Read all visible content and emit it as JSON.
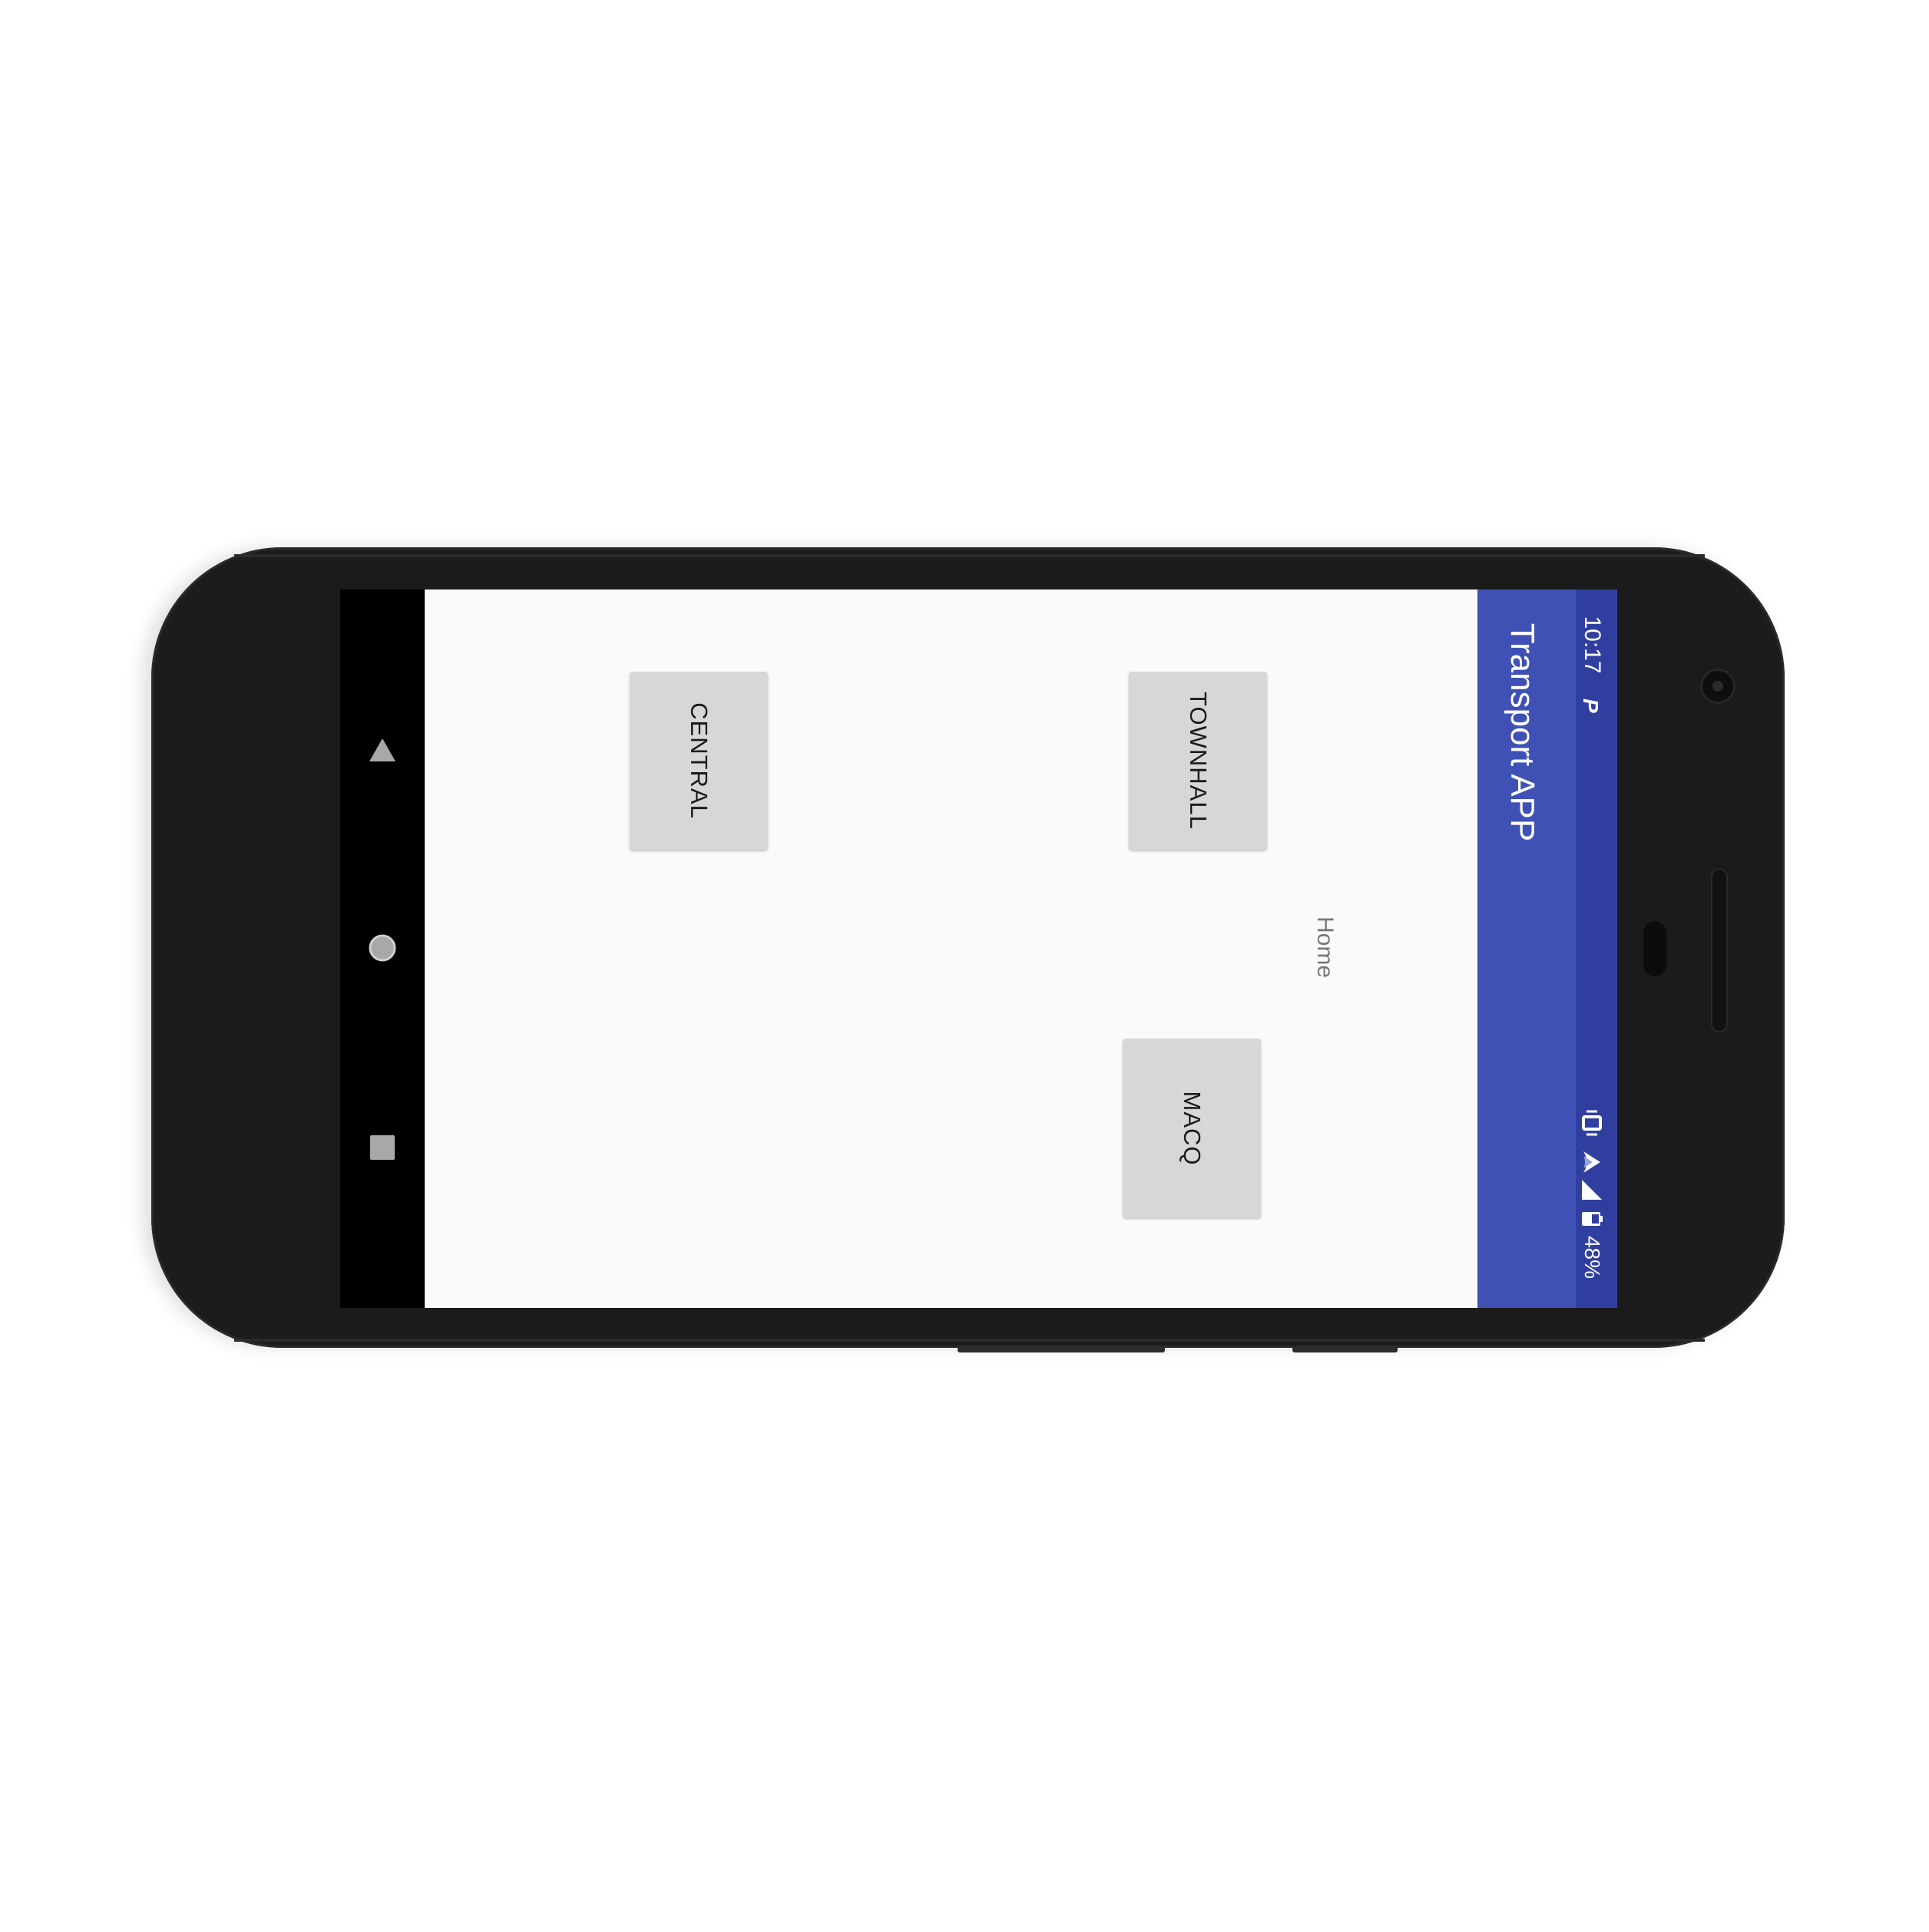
{
  "app": {
    "title": "Transport APP"
  },
  "status_bar": {
    "time": "10:17",
    "notification_icon": "parking-p-icon",
    "battery_percent": "48%",
    "icons": [
      "vibrate-icon",
      "wifi-icon",
      "cellular-signal-icon",
      "battery-icon"
    ]
  },
  "main": {
    "home_label": "Home",
    "buttons": {
      "central": "CENTRAL",
      "townhall": "TOWNHALL",
      "macq": "MACQ"
    }
  },
  "nav_bar": {
    "icons": [
      "back-icon",
      "home-icon",
      "recents-icon"
    ]
  },
  "colors": {
    "primary": "#3f51b5",
    "primary_dark": "#303f9f",
    "background": "#fafafa",
    "button": "#d6d7d7"
  }
}
